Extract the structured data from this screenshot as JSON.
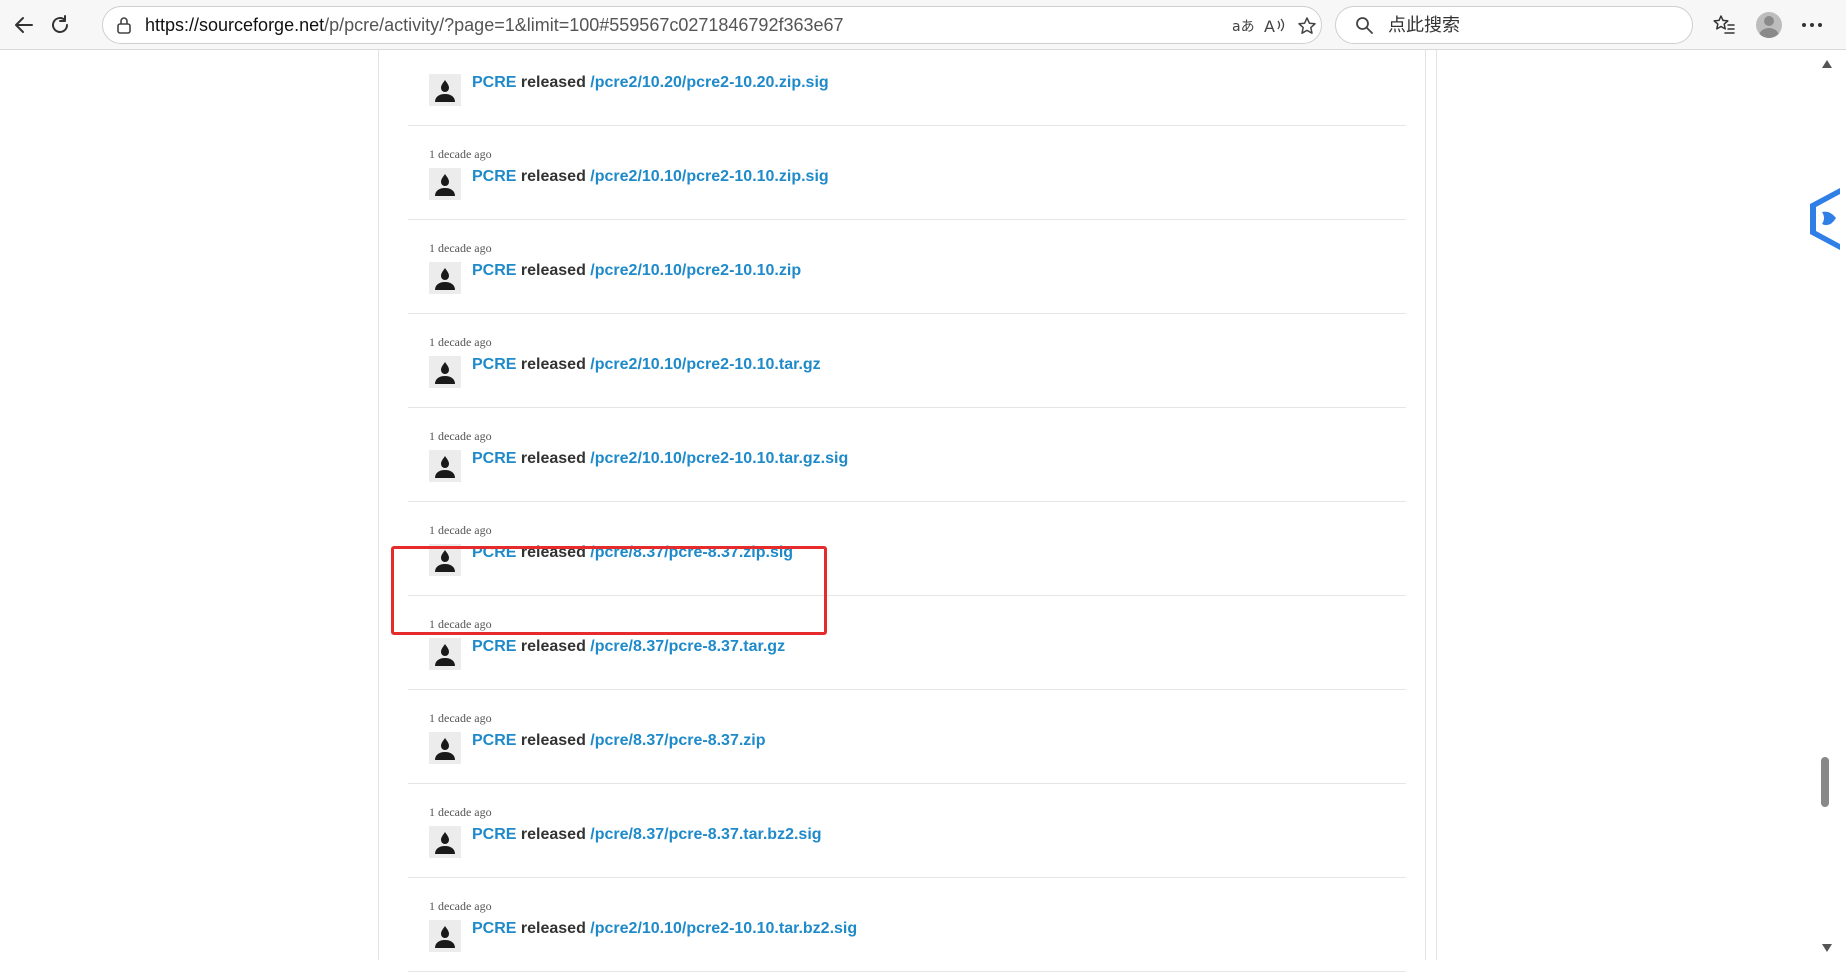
{
  "browser": {
    "url_host": "https://sourceforge.net",
    "url_rest": "/p/pcre/activity/?page=1&limit=100#559567c0271846792f363e67",
    "search_placeholder": "点此搜索"
  },
  "feed": {
    "project": "PCRE",
    "verb": "released",
    "entries": [
      {
        "timestamp": "",
        "path": "/pcre2/10.20/pcre2-10.20.zip.sig"
      },
      {
        "timestamp": "1 decade ago",
        "path": "/pcre2/10.10/pcre2-10.10.zip.sig"
      },
      {
        "timestamp": "1 decade ago",
        "path": "/pcre2/10.10/pcre2-10.10.zip"
      },
      {
        "timestamp": "1 decade ago",
        "path": "/pcre2/10.10/pcre2-10.10.tar.gz"
      },
      {
        "timestamp": "1 decade ago",
        "path": "/pcre2/10.10/pcre2-10.10.tar.gz.sig"
      },
      {
        "timestamp": "1 decade ago",
        "path": "/pcre/8.37/pcre-8.37.zip.sig"
      },
      {
        "timestamp": "1 decade ago",
        "path": "/pcre/8.37/pcre-8.37.tar.gz"
      },
      {
        "timestamp": "1 decade ago",
        "path": "/pcre/8.37/pcre-8.37.zip"
      },
      {
        "timestamp": "1 decade ago",
        "path": "/pcre/8.37/pcre-8.37.tar.bz2.sig"
      },
      {
        "timestamp": "1 decade ago",
        "path": "/pcre2/10.10/pcre2-10.10.tar.bz2.sig"
      }
    ]
  },
  "icons": {
    "back": "back-arrow-icon",
    "refresh": "refresh-icon",
    "lock": "lock-icon",
    "translate": "translate-icon",
    "read_aloud": "read-aloud-icon",
    "favorite": "star-icon",
    "search": "search-icon",
    "favorites_list": "favorites-icon",
    "profile": "profile-icon",
    "more": "more-icon",
    "user_avatar": "user-avatar-icon"
  },
  "colors": {
    "link": "#1f8ac9",
    "highlight": "#e52b2b"
  }
}
